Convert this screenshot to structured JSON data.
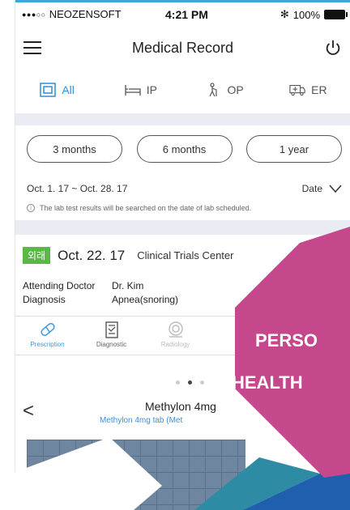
{
  "status_bar": {
    "signal_dots": "●●●○○",
    "carrier": "NEOZENSOFT",
    "time": "4:21 PM",
    "bluetooth": "✻",
    "battery_percent": "100%"
  },
  "nav": {
    "title": "Medical Record"
  },
  "tabs": [
    {
      "label": "All",
      "icon": "all-icon",
      "active": true
    },
    {
      "label": "IP",
      "icon": "bed-icon",
      "active": false
    },
    {
      "label": "OP",
      "icon": "walker-icon",
      "active": false
    },
    {
      "label": "ER",
      "icon": "ambulance-icon",
      "active": false
    }
  ],
  "periods": [
    "3 months",
    "6 months",
    "1 year"
  ],
  "date_range": "Oct. 1. 17 ~ Oct. 28. 17",
  "sort_label": "Date",
  "note": "The lab test results will be searched on the date of lab scheduled.",
  "record": {
    "badge": "외래",
    "date": "Oct. 22. 17",
    "department": "Clinical Trials Center",
    "doctor_label": "Attending Doctor",
    "doctor_value": "Dr. Kim",
    "diagnosis_label": "Diagnosis",
    "diagnosis_value": "Apnea(snoring)",
    "tabs": [
      {
        "label": "Prescription",
        "icon": "pill-icon",
        "state": "active"
      },
      {
        "label": "Diagnostic",
        "icon": "clipboard-icon",
        "state": "normal"
      },
      {
        "label": "Radiology",
        "icon": "scanner-icon",
        "state": "disabled"
      }
    ],
    "pager": {
      "current": 2,
      "total": 3
    },
    "drug_name": "Methylon 4mg",
    "drug_subtitle": "Methylon 4mg tab (Met"
  },
  "overlay": {
    "line1": "PERSO",
    "line2": "HEALTH",
    "hex_color": "#c5478c",
    "teal_color": "#2e8ba4",
    "blue_color": "#1f5fae"
  }
}
